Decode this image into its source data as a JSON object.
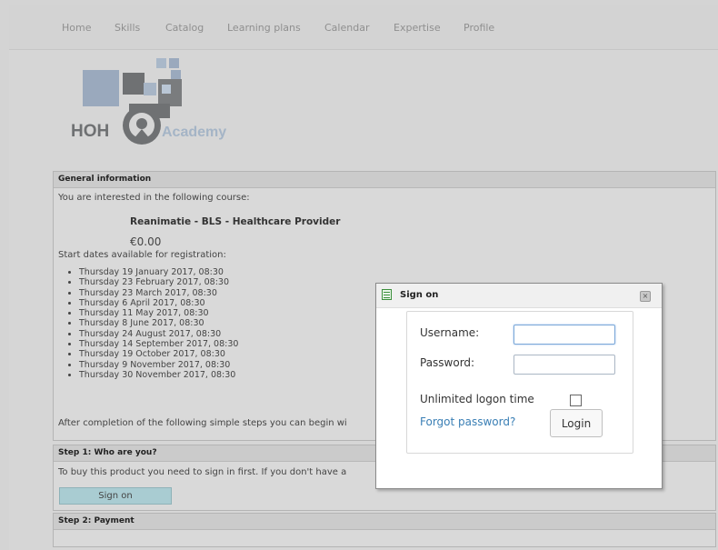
{
  "nav": {
    "items": [
      "Home",
      "Skills",
      "Catalog",
      "Learning plans",
      "Calendar",
      "Expertise",
      "Profile"
    ]
  },
  "logo": {
    "text_left": "HOH",
    "text_right": "Academy"
  },
  "general": {
    "header": "General information",
    "intro": "You are interested in the following course:",
    "course_name": "Reanimatie - BLS - Healthcare Provider",
    "price": "€0.00",
    "dates_label": "Start dates available for registration:",
    "dates": [
      "Thursday 19 January 2017, 08:30",
      "Thursday 23 February 2017, 08:30",
      "Thursday 23 March 2017, 08:30",
      "Thursday 6 April 2017, 08:30",
      "Thursday 11 May 2017, 08:30",
      "Thursday 8 June 2017, 08:30",
      "Thursday 24 August 2017, 08:30",
      "Thursday 14 September 2017, 08:30",
      "Thursday 19 October 2017, 08:30",
      "Thursday 9 November 2017, 08:30",
      "Thursday 30 November 2017, 08:30"
    ],
    "after_text": "After completion of the following simple steps you can begin wi"
  },
  "step1": {
    "header": "Step 1: Who are you?",
    "text": "To buy this product you need to sign in first. If you don't have a",
    "button": "Sign on"
  },
  "step2": {
    "header": "Step 2: Payment"
  },
  "dialog": {
    "title": "Sign on",
    "username_label": "Username:",
    "password_label": "Password:",
    "username_value": "",
    "password_value": "",
    "unlimited_label": "Unlimited logon time",
    "forgot_link": "Forgot password?",
    "login_button": "Login"
  },
  "colors": {
    "accent_button": "#a9ccd2",
    "link": "#3a7fb5"
  }
}
